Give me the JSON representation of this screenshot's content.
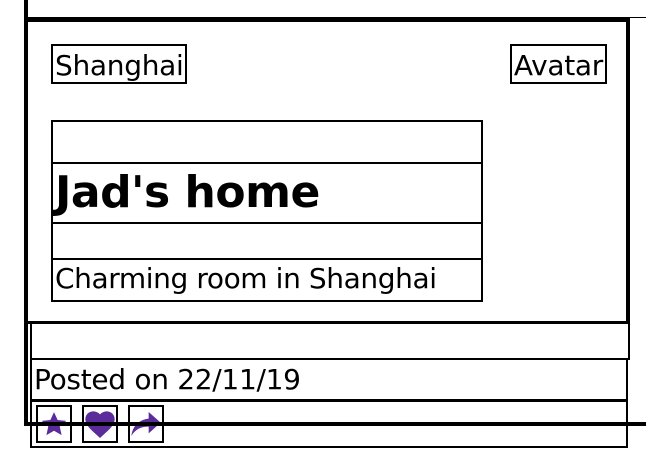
{
  "header": {
    "location": "Shanghai",
    "avatar": "Avatar"
  },
  "listing": {
    "title": "Jad's home",
    "subtitle": "Charming room in Shanghai"
  },
  "footer": {
    "posted": "Posted on 22/11/19"
  },
  "actions": [
    {
      "icon": "star-icon"
    },
    {
      "icon": "heart-icon"
    },
    {
      "icon": "share-icon"
    }
  ],
  "colors": {
    "icon": "#5b2a9b",
    "border": "#000000"
  }
}
